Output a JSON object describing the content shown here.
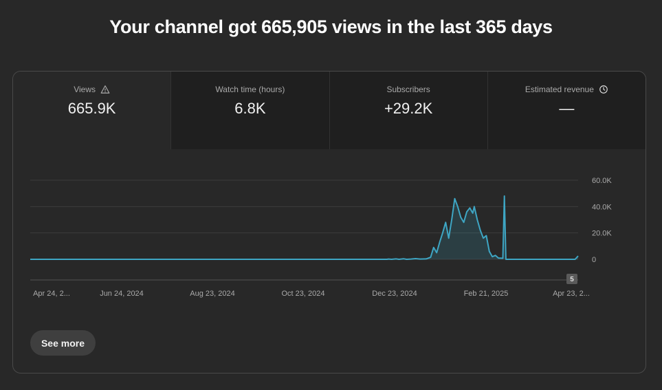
{
  "headline": "Your channel got 665,905 views in the last 365 days",
  "tabs": [
    {
      "label": "Views",
      "value": "665.9K",
      "icon": "warning-icon",
      "active": true
    },
    {
      "label": "Watch time (hours)",
      "value": "6.8K",
      "active": false
    },
    {
      "label": "Subscribers",
      "value": "+29.2K",
      "active": false
    },
    {
      "label": "Estimated revenue",
      "value": "—",
      "icon": "clock-icon",
      "active": false
    }
  ],
  "chart_data": {
    "type": "area",
    "y_ticks": [
      "60.0K",
      "40.0K",
      "20.0K",
      "0"
    ],
    "ylim": [
      0,
      60000
    ],
    "x_ticks": [
      "Apr 24, 2...",
      "Jun 24, 2024",
      "Aug 23, 2024",
      "Oct 23, 2024",
      "Dec 23, 2024",
      "Feb 21, 2025",
      "Apr 23, 2..."
    ],
    "x_range": [
      "2024-04-24",
      "2025-04-23"
    ],
    "marker_badge": "5",
    "series": [
      {
        "color": "#3ea6c4",
        "points": [
          [
            "2024-04-24",
            0
          ],
          [
            "2024-12-17",
            0
          ],
          [
            "2024-12-18",
            200
          ],
          [
            "2024-12-20",
            0
          ],
          [
            "2024-12-23",
            300
          ],
          [
            "2024-12-25",
            0
          ],
          [
            "2024-12-28",
            400
          ],
          [
            "2024-12-30",
            0
          ],
          [
            "2025-01-02",
            200
          ],
          [
            "2025-01-05",
            500
          ],
          [
            "2025-01-08",
            200
          ],
          [
            "2025-01-12",
            300
          ],
          [
            "2025-01-15",
            1500
          ],
          [
            "2025-01-17",
            9000
          ],
          [
            "2025-01-19",
            5000
          ],
          [
            "2025-01-21",
            13000
          ],
          [
            "2025-01-23",
            20000
          ],
          [
            "2025-01-25",
            28000
          ],
          [
            "2025-01-27",
            16000
          ],
          [
            "2025-01-29",
            30000
          ],
          [
            "2025-01-31",
            46000
          ],
          [
            "2025-02-02",
            40000
          ],
          [
            "2025-02-04",
            32000
          ],
          [
            "2025-02-06",
            28000
          ],
          [
            "2025-02-08",
            36000
          ],
          [
            "2025-02-10",
            39000
          ],
          [
            "2025-02-12",
            35000
          ],
          [
            "2025-02-13",
            40000
          ],
          [
            "2025-02-15",
            30000
          ],
          [
            "2025-02-17",
            22000
          ],
          [
            "2025-02-19",
            16000
          ],
          [
            "2025-02-21",
            18000
          ],
          [
            "2025-02-23",
            6000
          ],
          [
            "2025-02-25",
            2000
          ],
          [
            "2025-02-27",
            3000
          ],
          [
            "2025-03-01",
            1000
          ],
          [
            "2025-03-04",
            800
          ],
          [
            "2025-03-05",
            48000
          ],
          [
            "2025-03-06",
            0
          ],
          [
            "2025-04-21",
            0
          ],
          [
            "2025-04-23",
            2500
          ]
        ]
      }
    ]
  },
  "see_more_label": "See more"
}
